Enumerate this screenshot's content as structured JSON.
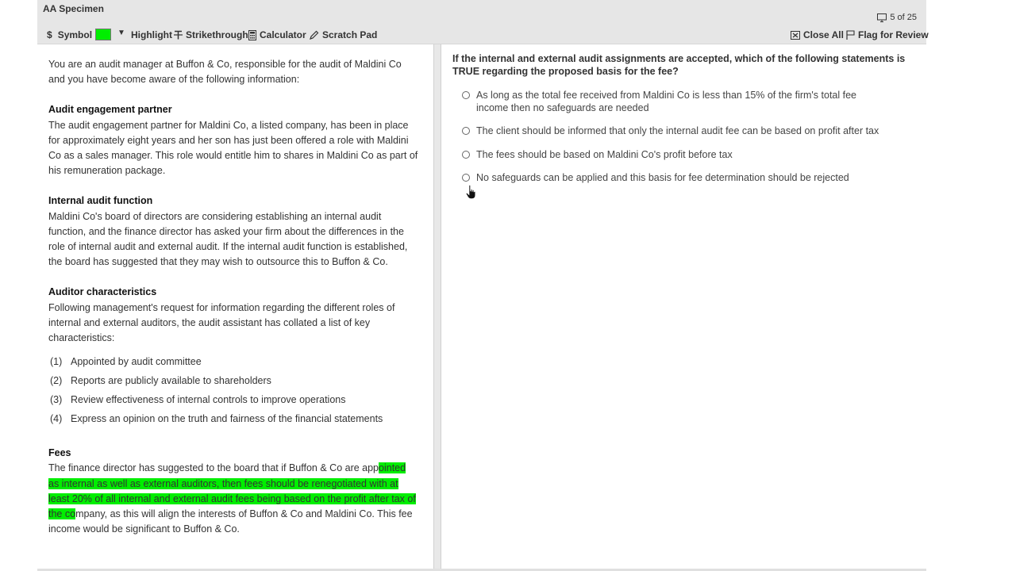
{
  "app": {
    "title": "AA Specimen",
    "progress": "5 of 25"
  },
  "toolbar": {
    "symbol": "Symbol",
    "highlight_color": "#00ee00",
    "highlight": "Highlight",
    "strikethrough": "Strikethrough",
    "calculator": "Calculator",
    "scratch_pad": "Scratch Pad",
    "close_all": "Close All",
    "flag": "Flag for Review"
  },
  "scenario": {
    "intro": "You are an audit manager at Buffon & Co, responsible for the audit of Maldini Co and you have become aware of the following information:",
    "sections": [
      {
        "heading": "Audit engagement partner",
        "body": "The audit engagement partner for Maldini Co, a listed company, has been in place for approximately eight years and her son has just been offered a role with Maldini Co as a sales manager. This role would entitle him to shares in Maldini Co as part of his remuneration package."
      },
      {
        "heading": "Internal audit function",
        "body": "Maldini Co's board of directors are considering establishing an internal audit function, and the finance director has asked your firm about the differences in the role of internal audit and external audit. If the internal audit function is established, the board has suggested that they may wish to outsource this to Buffon & Co."
      },
      {
        "heading": "Auditor characteristics",
        "body": "Following management's request for information regarding the different roles of internal and external auditors, the audit assistant has collated a list of key characteristics:"
      }
    ],
    "characteristics": [
      {
        "num": "(1)",
        "text": "Appointed by audit committee"
      },
      {
        "num": "(2)",
        "text": "Reports are publicly available to shareholders"
      },
      {
        "num": "(3)",
        "text": "Review effectiveness of internal controls to improve operations"
      },
      {
        "num": "(4)",
        "text": "Express an opinion on the truth and fairness of the financial statements"
      }
    ],
    "fees": {
      "heading": "Fees",
      "before": "The finance director has suggested to the board that if Buffon & Co are app",
      "highlighted": "ointed as internal as well as external auditors, then fees should be renegotiated with at least 20% of all internal and external audit fees being based on the profit after tax of the co",
      "after": "mpany, as this will align the interests of Buffon & Co and Maldini Co. This fee income would be significant to Buffon & Co."
    }
  },
  "question": {
    "text": "If the internal and external audit assignments are accepted, which of the following statements is TRUE regarding the proposed basis for the fee?",
    "options": [
      "As long as the total fee received from Maldini Co is less than 15% of the firm's total fee income then no safeguards are needed",
      "The client should be informed that only the internal audit fee can be based on profit after tax",
      "The fees should be based on Maldini Co's profit before tax",
      "No safeguards can be applied and this basis for fee determination should be rejected"
    ]
  }
}
